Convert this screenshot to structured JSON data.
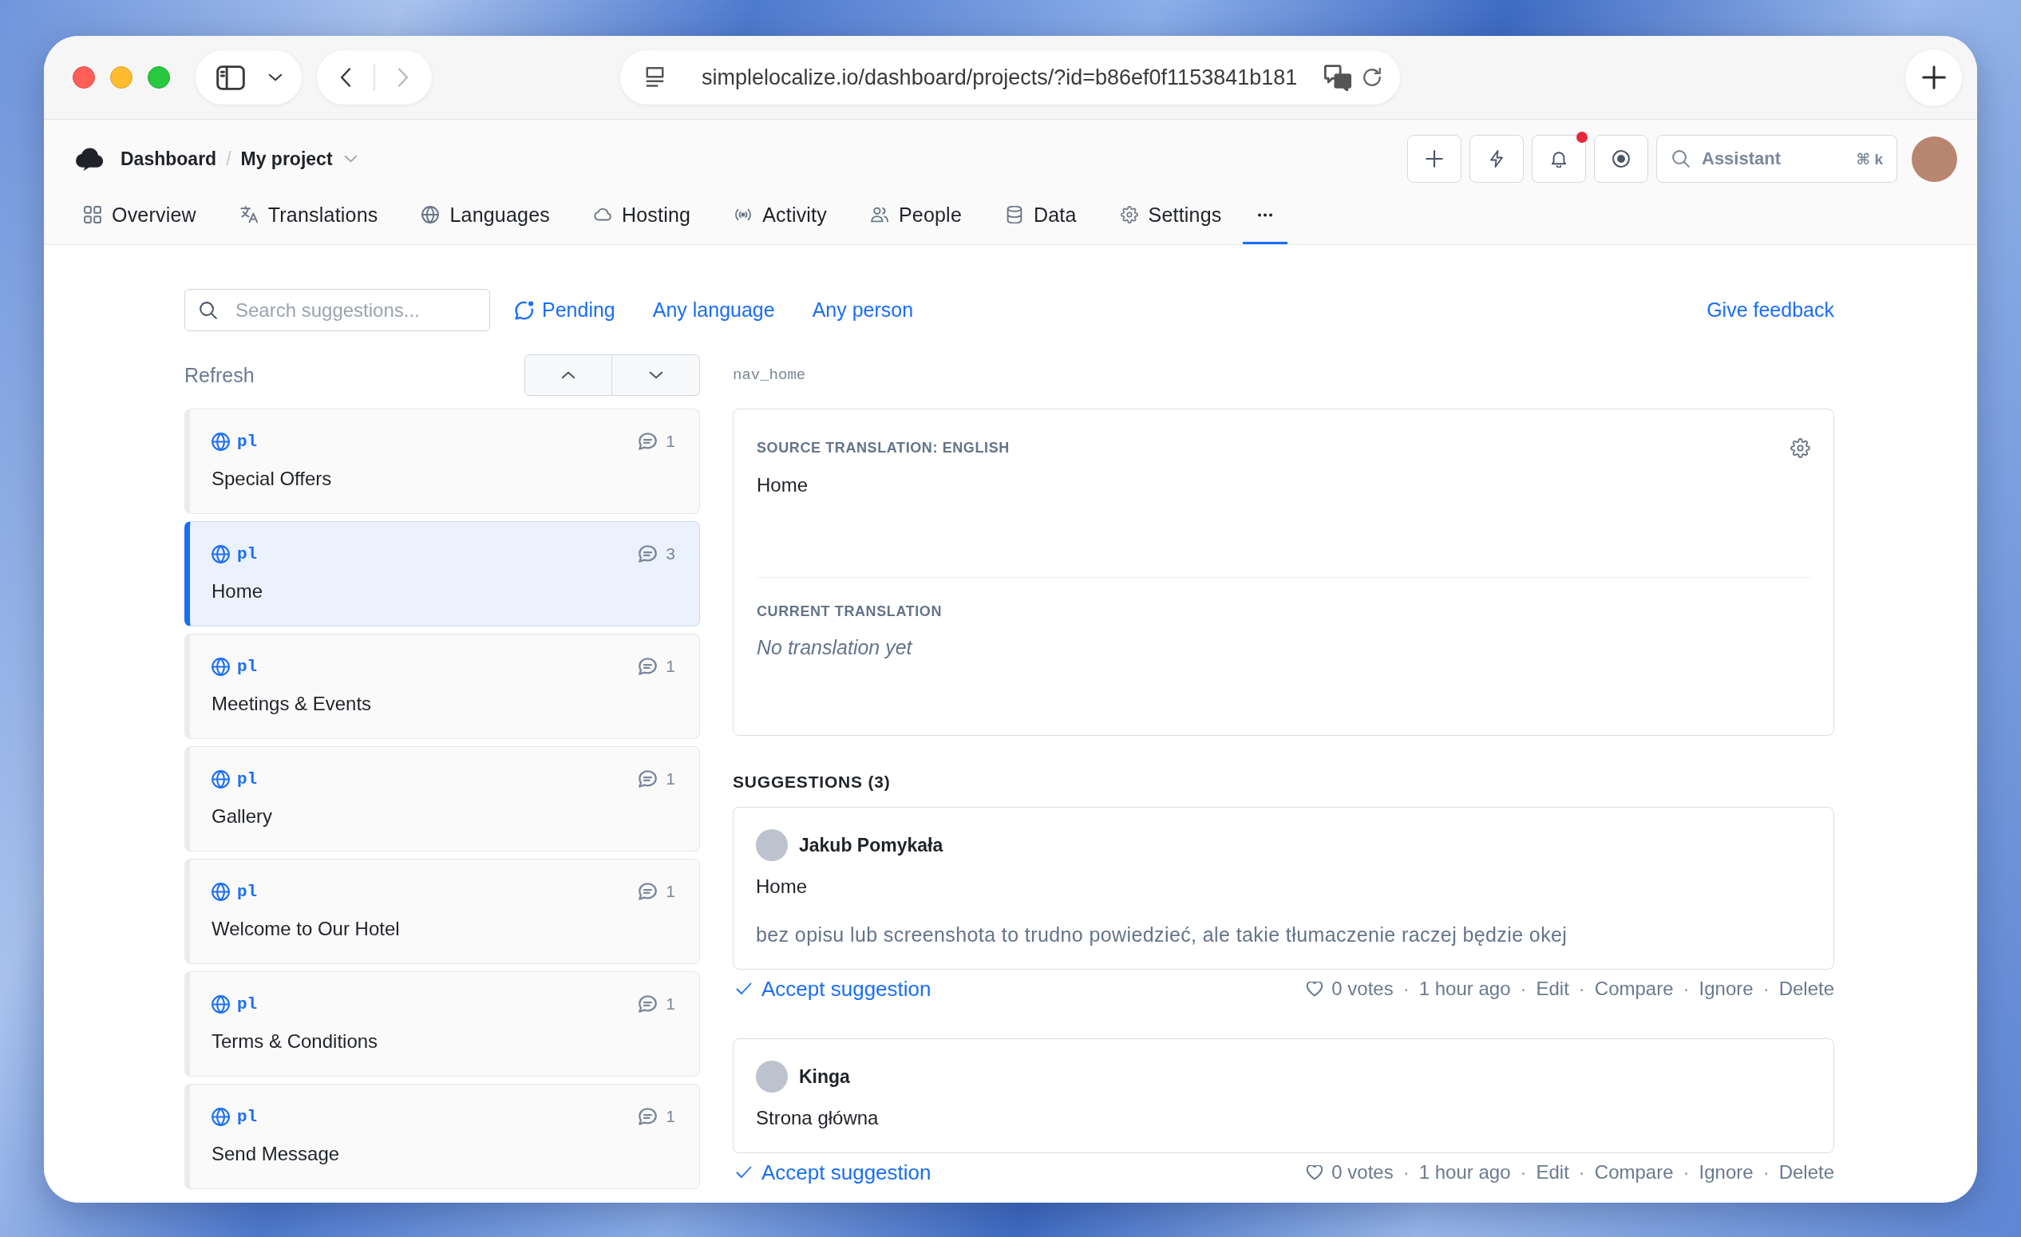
{
  "browser": {
    "url": "simplelocalize.io/dashboard/projects/?id=b86ef0f1153841b181",
    "forward_disabled": true
  },
  "header": {
    "breadcrumb": [
      {
        "label": "Dashboard"
      },
      {
        "label": "My project"
      }
    ],
    "separator": "/",
    "notifications": {
      "unread": true
    },
    "assistant": {
      "placeholder": "Assistant",
      "shortcut": "⌘ k"
    }
  },
  "tabs": [
    {
      "kind": "label",
      "label": "Overview",
      "selected": false
    },
    {
      "kind": "label",
      "label": "Translations",
      "selected": false
    },
    {
      "kind": "label",
      "label": "Languages",
      "selected": false
    },
    {
      "kind": "label",
      "label": "Hosting",
      "selected": false
    },
    {
      "kind": "label",
      "label": "Activity",
      "selected": false
    },
    {
      "kind": "label",
      "label": "People",
      "selected": false
    },
    {
      "kind": "label",
      "label": "Data",
      "selected": false
    },
    {
      "kind": "label",
      "label": "Settings",
      "selected": false
    },
    {
      "kind": "more",
      "selected": true
    }
  ],
  "filters": {
    "search": {
      "placeholder": "Search suggestions..."
    },
    "options": [
      {
        "kind": "status",
        "label": "Pending"
      },
      {
        "kind": "language",
        "label": "Any language"
      },
      {
        "kind": "person",
        "label": "Any person"
      }
    ],
    "feedback": "Give feedback"
  },
  "list": {
    "refresh": "Refresh",
    "items": [
      {
        "language": "pl",
        "count": "1",
        "title": "Special Offers",
        "selected": false
      },
      {
        "language": "pl",
        "count": "3",
        "title": "Home",
        "selected": true
      },
      {
        "language": "pl",
        "count": "1",
        "title": "Meetings & Events",
        "selected": false
      },
      {
        "language": "pl",
        "count": "1",
        "title": "Gallery",
        "selected": false
      },
      {
        "language": "pl",
        "count": "1",
        "title": "Welcome to Our Hotel",
        "selected": false
      },
      {
        "language": "pl",
        "count": "1",
        "title": "Terms & Conditions",
        "selected": false
      },
      {
        "language": "pl",
        "count": "1",
        "title": "Send Message",
        "selected": false
      }
    ]
  },
  "detail": {
    "key": "nav_home",
    "source_label": "SOURCE TRANSLATION: ENGLISH",
    "source_text": "Home",
    "current_label": "CURRENT TRANSLATION",
    "current_text": "No translation yet",
    "current_empty": true
  },
  "suggestions": {
    "title": "SUGGESTIONS (3)",
    "separator": "·",
    "items": [
      {
        "author": "Jakub Pomykała",
        "text": "Home",
        "comment": "bez opisu lub screenshota to trudno powiedzieć, ale takie tłumaczenie raczej będzie okej",
        "accept": "Accept suggestion",
        "votes": "0 votes",
        "time": "1 hour ago",
        "actions": [
          "Edit",
          "Compare",
          "Ignore",
          "Delete"
        ]
      },
      {
        "author": "Kinga",
        "text": "Strona główna",
        "accept": "Accept suggestion",
        "votes": "0 votes",
        "time": "1 hour ago",
        "actions": [
          "Edit",
          "Compare",
          "Ignore",
          "Delete"
        ]
      }
    ]
  }
}
